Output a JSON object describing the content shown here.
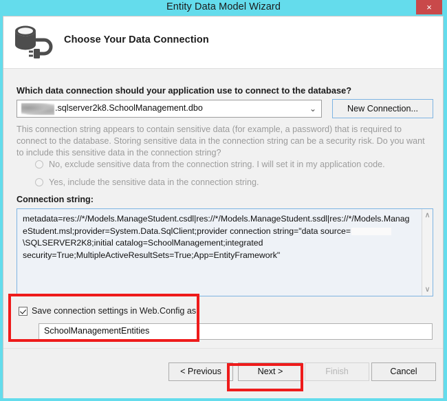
{
  "window": {
    "title": "Entity Data Model Wizard",
    "close_label": "×"
  },
  "header": {
    "icon": "database-connection-icon",
    "title": "Choose Your Data Connection"
  },
  "main": {
    "prompt": "Which data connection should your application use to connect to the database?",
    "connection_combo": {
      "value": ".sqlserver2k8.SchoolManagement.dbo",
      "redacted": true,
      "arrow": "⌄"
    },
    "new_connection_button": "New Connection...",
    "sensitive_warning": "This connection string appears to contain sensitive data (for example, a password) that is required to connect to the database. Storing sensitive data in the connection string can be a security risk. Do you want to include this sensitive data in the connection string?",
    "radio_options": [
      {
        "label": "No, exclude sensitive data from the connection string. I will set it in my application code.",
        "selected": false,
        "disabled": true
      },
      {
        "label": "Yes, include the sensitive data in the connection string.",
        "selected": false,
        "disabled": true
      }
    ],
    "connection_string_label": "Connection string:",
    "connection_string_before_redaction": "metadata=res://*/Models.ManageStudent.csdl|res://*/Models.ManageStudent.ssdl|res://*/Models.ManageStudent.msl;provider=System.Data.SqlClient;provider connection string=\"data source=",
    "connection_string_after_redaction": "\\SQLSERVER2K8;initial catalog=SchoolManagement;integrated security=True;MultipleActiveResultSets=True;App=EntityFramework\"",
    "scroll_up": "∧",
    "scroll_down": "∨",
    "save_checkbox": {
      "label": "Save connection settings in Web.Config as:",
      "checked": true
    },
    "entities_name_input": {
      "value": "SchoolManagementEntities",
      "placeholder": ""
    }
  },
  "footer": {
    "previous_label": "< Previous",
    "next_label": "Next >",
    "finish_label": "Finish",
    "cancel_label": "Cancel",
    "finish_disabled": true
  },
  "annotations": {
    "highlight_color": "#ee1b1b",
    "boxes": [
      "save-connection-settings",
      "next-button"
    ]
  },
  "colors": {
    "titlebar": "#64dcec",
    "close_button": "#c9494a",
    "dialog_body": "#f1f1f1",
    "focus_border": "#7eb4e2",
    "annotation_red": "#ee1b1b"
  }
}
